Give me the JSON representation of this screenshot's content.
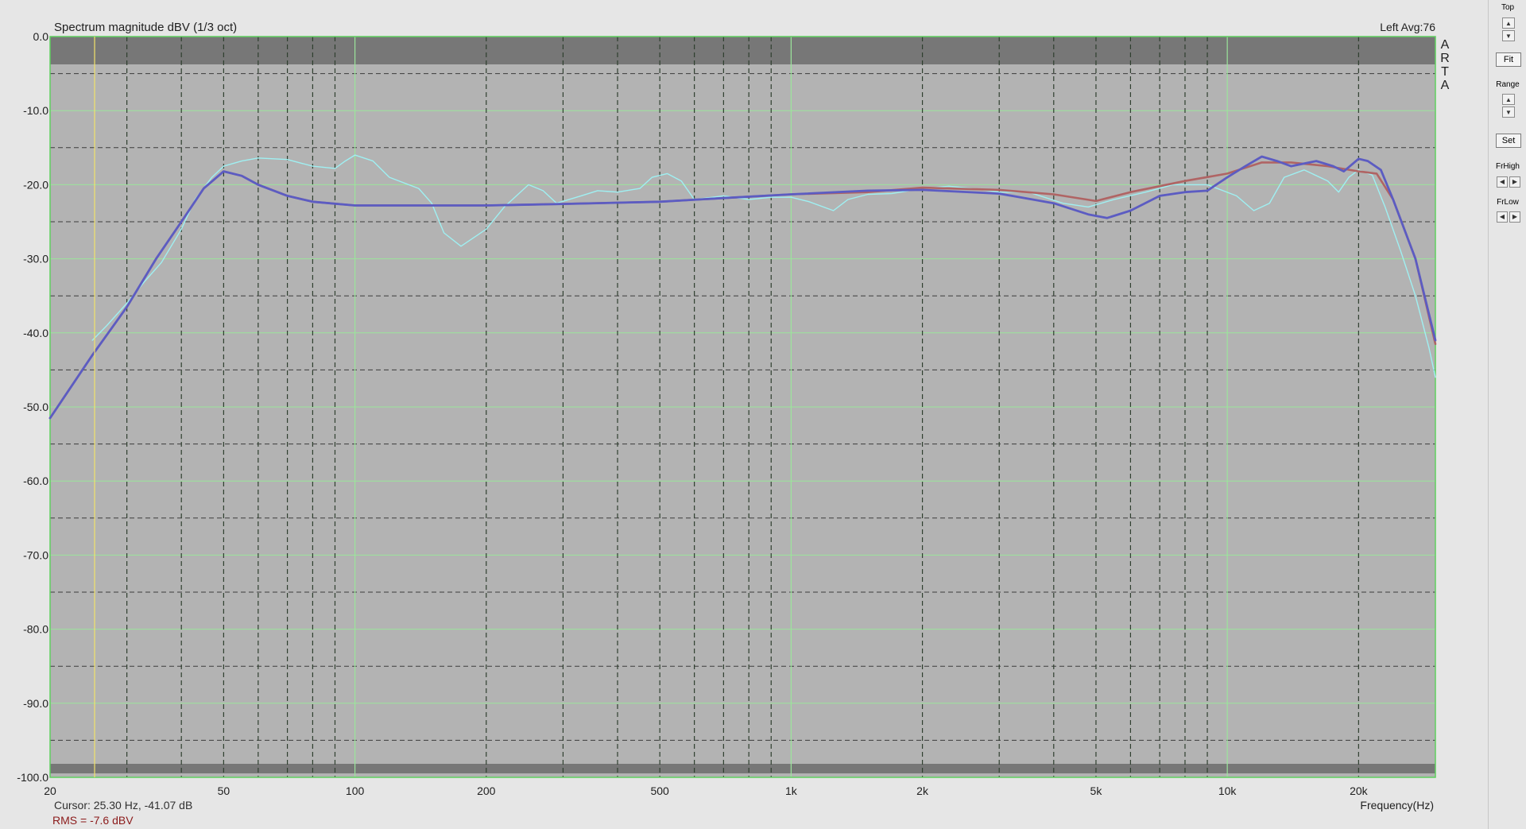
{
  "chart_data": {
    "type": "line",
    "title": "Spectrum magnitude dBV (1/3 oct)",
    "top_right_label": "Left  Avg:76",
    "brand_letters": [
      "A",
      "R",
      "T",
      "A"
    ],
    "xlabel": "Frequency(Hz)",
    "xscale": "log",
    "xlim": [
      20,
      30000
    ],
    "ylim": [
      -100,
      0
    ],
    "grid": true,
    "y_ticks": [
      "0.0",
      "-10.0",
      "-20.0",
      "-30.0",
      "-40.0",
      "-50.0",
      "-60.0",
      "-70.0",
      "-80.0",
      "-90.0",
      "-100.0"
    ],
    "x_tick_labels": [
      {
        "value": 20,
        "label": "20"
      },
      {
        "value": 50,
        "label": "50"
      },
      {
        "value": 100,
        "label": "100"
      },
      {
        "value": 200,
        "label": "200"
      },
      {
        "value": 500,
        "label": "500"
      },
      {
        "value": 1000,
        "label": "1k"
      },
      {
        "value": 2000,
        "label": "2k"
      },
      {
        "value": 5000,
        "label": "5k"
      },
      {
        "value": 10000,
        "label": "10k"
      },
      {
        "value": 20000,
        "label": "20k"
      }
    ],
    "cursor": {
      "freq": 25.3,
      "text": "Cursor:    25.30 Hz,  -41.07 dB"
    },
    "rms_text": "RMS =    -7.6 dBV",
    "series": [
      {
        "color": "#9ff0f2",
        "width": 1.4,
        "points": [
          [
            25,
            -41
          ],
          [
            27,
            -39
          ],
          [
            30,
            -36
          ],
          [
            33,
            -33
          ],
          [
            36,
            -30.5
          ],
          [
            40,
            -26
          ],
          [
            43,
            -22
          ],
          [
            47,
            -19
          ],
          [
            50,
            -17.5
          ],
          [
            55,
            -16.8
          ],
          [
            60,
            -16.4
          ],
          [
            70,
            -16.6
          ],
          [
            80,
            -17.5
          ],
          [
            90,
            -17.8
          ],
          [
            95,
            -16.8
          ],
          [
            100,
            -16
          ],
          [
            110,
            -16.8
          ],
          [
            120,
            -19
          ],
          [
            140,
            -20.5
          ],
          [
            150,
            -22.5
          ],
          [
            160,
            -26.5
          ],
          [
            175,
            -28.3
          ],
          [
            200,
            -26
          ],
          [
            220,
            -23
          ],
          [
            250,
            -20
          ],
          [
            270,
            -20.8
          ],
          [
            290,
            -22.5
          ],
          [
            330,
            -21.5
          ],
          [
            360,
            -20.8
          ],
          [
            400,
            -21
          ],
          [
            450,
            -20.5
          ],
          [
            480,
            -19
          ],
          [
            520,
            -18.5
          ],
          [
            560,
            -19.5
          ],
          [
            600,
            -22
          ],
          [
            700,
            -21.5
          ],
          [
            800,
            -22
          ],
          [
            900,
            -21.7
          ],
          [
            1000,
            -21.7
          ],
          [
            1100,
            -22.3
          ],
          [
            1250,
            -23.5
          ],
          [
            1350,
            -22
          ],
          [
            1500,
            -21.3
          ],
          [
            1700,
            -21.2
          ],
          [
            2000,
            -20.5
          ],
          [
            2300,
            -20.2
          ],
          [
            2600,
            -20.5
          ],
          [
            3000,
            -21
          ],
          [
            3500,
            -21
          ],
          [
            4200,
            -22.5
          ],
          [
            4800,
            -23
          ],
          [
            5500,
            -22
          ],
          [
            6500,
            -21
          ],
          [
            7500,
            -20
          ],
          [
            9000,
            -20
          ],
          [
            10500,
            -21.5
          ],
          [
            11500,
            -23.5
          ],
          [
            12500,
            -22.5
          ],
          [
            13500,
            -19
          ],
          [
            15000,
            -18
          ],
          [
            17000,
            -19.5
          ],
          [
            18000,
            -21
          ],
          [
            19000,
            -19
          ],
          [
            20000,
            -18
          ],
          [
            21500,
            -18.7
          ],
          [
            23000,
            -23
          ],
          [
            25000,
            -29
          ],
          [
            27000,
            -35
          ],
          [
            29000,
            -42
          ],
          [
            30000,
            -46
          ]
        ]
      },
      {
        "color": "#b06464",
        "width": 2.6,
        "points": [
          [
            20,
            -51.5
          ],
          [
            25,
            -43
          ],
          [
            30,
            -36.5
          ],
          [
            35,
            -30
          ],
          [
            40,
            -25
          ],
          [
            45,
            -20.5
          ],
          [
            50,
            -18.2
          ],
          [
            55,
            -18.8
          ],
          [
            60,
            -20
          ],
          [
            70,
            -21.5
          ],
          [
            80,
            -22.3
          ],
          [
            100,
            -22.8
          ],
          [
            150,
            -22.8
          ],
          [
            200,
            -22.8
          ],
          [
            300,
            -22.6
          ],
          [
            500,
            -22.3
          ],
          [
            700,
            -21.8
          ],
          [
            1000,
            -21.3
          ],
          [
            1500,
            -21
          ],
          [
            2000,
            -20.4
          ],
          [
            3000,
            -20.7
          ],
          [
            4000,
            -21.3
          ],
          [
            5000,
            -22.2
          ],
          [
            6000,
            -21
          ],
          [
            8000,
            -19.5
          ],
          [
            10000,
            -18.5
          ],
          [
            12000,
            -17
          ],
          [
            14000,
            -17
          ],
          [
            17000,
            -17.5
          ],
          [
            20000,
            -18.2
          ],
          [
            22000,
            -18.5
          ],
          [
            24000,
            -22
          ],
          [
            27000,
            -30
          ],
          [
            30000,
            -41.5
          ]
        ]
      },
      {
        "color": "#5c5cc2",
        "width": 2.8,
        "points": [
          [
            20,
            -51.5
          ],
          [
            25,
            -43
          ],
          [
            30,
            -36.5
          ],
          [
            35,
            -30
          ],
          [
            40,
            -25
          ],
          [
            45,
            -20.5
          ],
          [
            50,
            -18.2
          ],
          [
            55,
            -18.8
          ],
          [
            60,
            -20
          ],
          [
            70,
            -21.5
          ],
          [
            80,
            -22.3
          ],
          [
            100,
            -22.8
          ],
          [
            150,
            -22.8
          ],
          [
            200,
            -22.8
          ],
          [
            300,
            -22.6
          ],
          [
            500,
            -22.3
          ],
          [
            700,
            -21.8
          ],
          [
            1000,
            -21.3
          ],
          [
            1500,
            -20.8
          ],
          [
            2000,
            -20.7
          ],
          [
            3000,
            -21.2
          ],
          [
            4000,
            -22.5
          ],
          [
            4800,
            -24
          ],
          [
            5300,
            -24.5
          ],
          [
            6000,
            -23.5
          ],
          [
            7000,
            -21.5
          ],
          [
            8000,
            -21
          ],
          [
            9000,
            -20.8
          ],
          [
            10000,
            -19
          ],
          [
            11000,
            -17.5
          ],
          [
            12000,
            -16.2
          ],
          [
            13000,
            -16.8
          ],
          [
            14000,
            -17.5
          ],
          [
            16000,
            -16.8
          ],
          [
            17500,
            -17.5
          ],
          [
            18500,
            -18.2
          ],
          [
            20000,
            -16.5
          ],
          [
            21000,
            -16.8
          ],
          [
            22500,
            -18
          ],
          [
            24000,
            -22
          ],
          [
            27000,
            -30
          ],
          [
            30000,
            -41
          ]
        ]
      }
    ]
  },
  "side_panel": {
    "top_label": "Top",
    "fit_label": "Fit",
    "range_label": "Range",
    "set_label": "Set",
    "frhigh_label": "FrHigh",
    "frlow_label": "FrLow"
  }
}
